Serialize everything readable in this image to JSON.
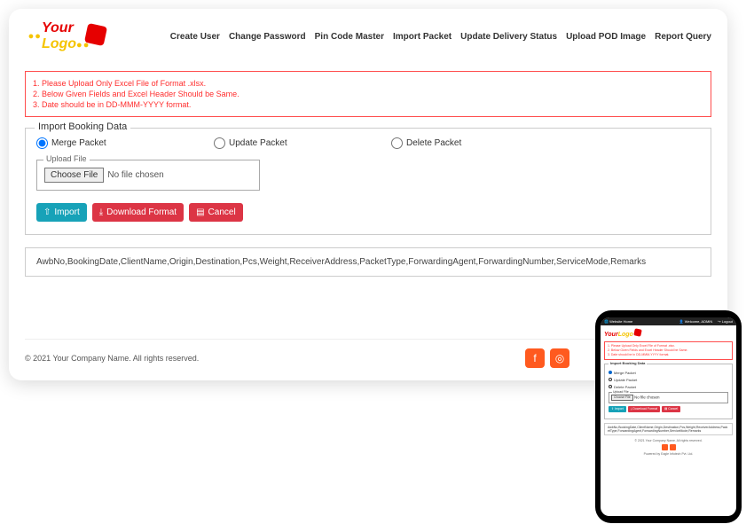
{
  "logo": {
    "your": "Your",
    "logo": "Logo"
  },
  "nav": {
    "create_user": "Create User",
    "change_password": "Change Password",
    "pin_code_master": "Pin Code Master",
    "import_packet": "Import Packet",
    "update_delivery": "Update Delivery Status",
    "upload_pod": "Upload POD Image",
    "report_query": "Report Query"
  },
  "alerts": {
    "line1": "1. Please Upload Only Excel File of Format .xlsx.",
    "line2": "2. Below Given Fields and Excel Header Should be Same.",
    "line3": "3. Date should be in DD-MMM-YYYY format."
  },
  "form": {
    "legend": "Import Booking Data",
    "merge": "Merge Packet",
    "update": "Update Packet",
    "delete": "Delete Packet",
    "upload_legend": "Upload File",
    "choose_file": "Choose File",
    "no_file": "No file chosen",
    "import_btn": "Import",
    "download_btn": "Download Format",
    "cancel_btn": "Cancel"
  },
  "columns_text": "AwbNo,BookingDate,ClientName,Origin,Destination,Pcs,Weight,ReceiverAddress,PacketType,ForwardingAgent,ForwardingNumber,ServiceMode,Remarks",
  "footer": {
    "copyright": "© 2021 Your Company Name. All rights reserved."
  },
  "phone": {
    "topbar_home": "Website Home",
    "topbar_welcome": "Welcome, ADMIN",
    "topbar_logout": "Logout",
    "powered": "Powered by Eagle Infotech Pvt. Ltd."
  }
}
